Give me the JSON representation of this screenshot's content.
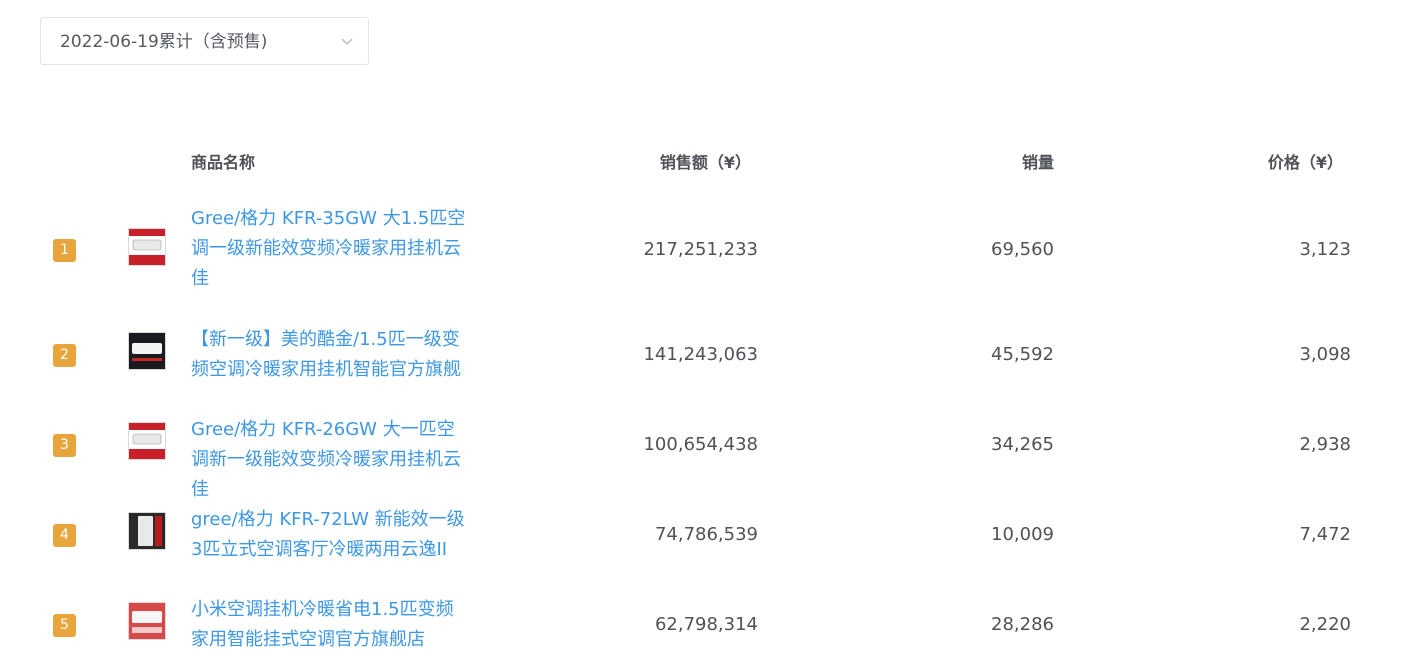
{
  "filter": {
    "date_label": "2022-06-19累计（含预售)",
    "chevron_icon": "chevron-down-icon"
  },
  "table": {
    "headers": {
      "name": "商品名称",
      "sales": "销售额（¥）",
      "qty": "销量",
      "price": "价格（¥）"
    },
    "rows": [
      {
        "rank": "1",
        "name": "Gree/格力 KFR-35GW 大1.5匹空调一级新能效变频冷暖家用挂机云佳",
        "sales": "217,251,233",
        "qty": "69,560",
        "price": "3,123"
      },
      {
        "rank": "2",
        "name": "【新一级】美的酷金/1.5匹一级变频空调冷暖家用挂机智能官方旗舰",
        "sales": "141,243,063",
        "qty": "45,592",
        "price": "3,098"
      },
      {
        "rank": "3",
        "name": "Gree/格力 KFR-26GW 大一匹空调新一级能效变频冷暖家用挂机云佳",
        "sales": "100,654,438",
        "qty": "34,265",
        "price": "2,938"
      },
      {
        "rank": "4",
        "name": "gree/格力 KFR-72LW 新能效一级3匹立式空调客厅冷暖两用云逸II",
        "sales": "74,786,539",
        "qty": "10,009",
        "price": "7,472"
      },
      {
        "rank": "5",
        "name": "小米空调挂机冷暖省电1.5匹变频家用智能挂式空调官方旗舰店",
        "sales": "62,798,314",
        "qty": "28,286",
        "price": "2,220"
      }
    ]
  },
  "colors": {
    "rank_badge": "#e8a53c",
    "link": "#3e97e6",
    "text": "#4f5358"
  }
}
